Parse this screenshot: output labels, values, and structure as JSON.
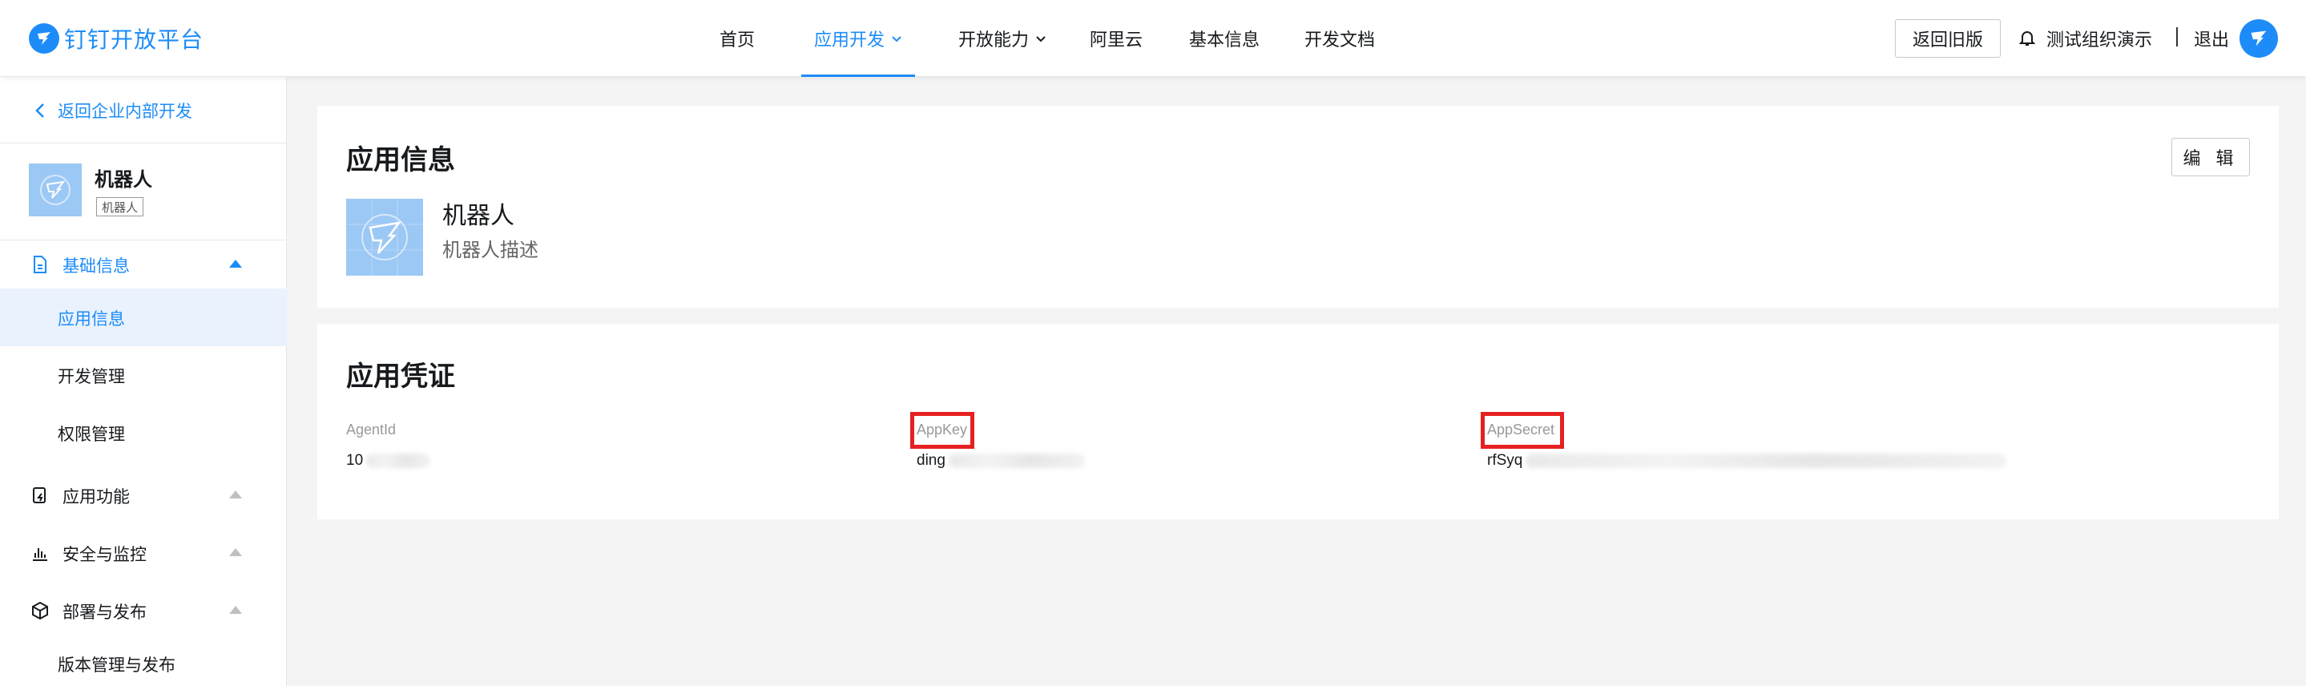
{
  "header": {
    "logo_text": "钉钉开放平台",
    "nav": [
      {
        "label": "首页"
      },
      {
        "label": "应用开发"
      },
      {
        "label": "开放能力"
      },
      {
        "label": "阿里云"
      },
      {
        "label": "基本信息"
      },
      {
        "label": "开发文档"
      }
    ],
    "old_version_button": "返回旧版",
    "org_name": "测试组织演示",
    "logout": "退出",
    "icons": {
      "logo": "dingtalk-logo-icon",
      "bell": "bell-icon",
      "avatar": "dingtalk-avatar-icon"
    }
  },
  "sidebar": {
    "back_link": "返回企业内部开发",
    "app": {
      "name": "机器人",
      "tag": "机器人"
    },
    "groups": [
      {
        "label": "基础信息",
        "icon": "document-icon",
        "expanded": true,
        "items": [
          "应用信息",
          "开发管理",
          "权限管理"
        ],
        "selected": "应用信息"
      },
      {
        "label": "应用功能",
        "icon": "app-function-icon",
        "expanded": false
      },
      {
        "label": "安全与监控",
        "icon": "bar-chart-icon",
        "expanded": false
      },
      {
        "label": "部署与发布",
        "icon": "cube-icon",
        "expanded": true,
        "items": [
          "版本管理与发布"
        ]
      }
    ]
  },
  "app_info": {
    "title": "应用信息",
    "edit_button": "编 辑",
    "name": "机器人",
    "description": "机器人描述"
  },
  "credentials": {
    "title": "应用凭证",
    "fields": [
      {
        "label": "AgentId",
        "value_prefix": "10",
        "masked": true
      },
      {
        "label": "AppKey",
        "value_prefix": "ding",
        "masked": true,
        "highlighted": true
      },
      {
        "label": "AppSecret",
        "value_prefix": "rfSyq",
        "masked": true,
        "highlighted": true
      }
    ]
  },
  "colors": {
    "accent": "#1d8cf8",
    "highlight": "#e62020",
    "app_icon_bg": "#9cc8f5"
  }
}
